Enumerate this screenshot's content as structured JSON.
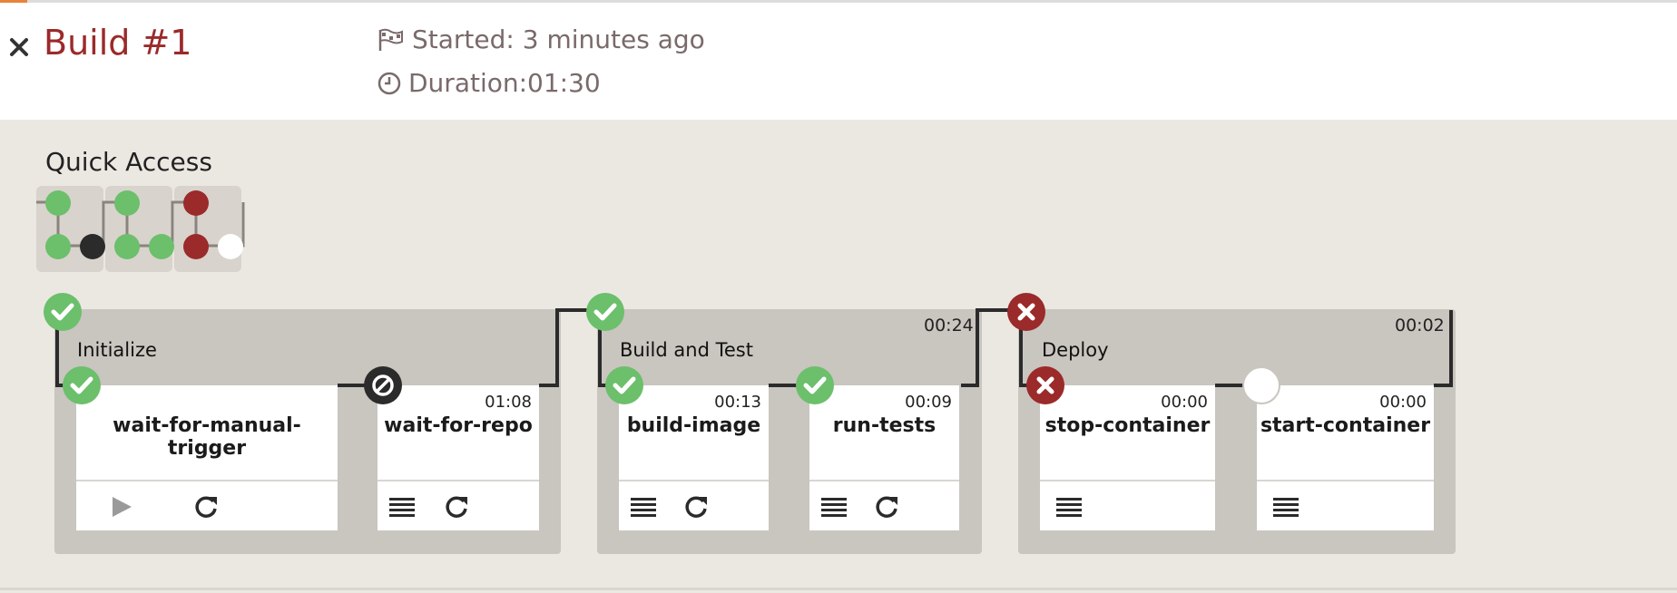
{
  "header": {
    "close_icon": "close-x-icon",
    "title": "Build #1",
    "started": "Started: 3 minutes ago",
    "duration": "Duration:01:30",
    "started_icon": "flag-icon",
    "duration_icon": "clock-icon"
  },
  "colors": {
    "title": "#9b2a2a",
    "success": "#6cbf6b",
    "failure": "#9b2a2a",
    "blocked": "#2b2b2b",
    "pending": "#ffffff",
    "stage_bg": "#c9c5bf",
    "page_bg": "#ebe8e2"
  },
  "quick_access": {
    "title": "Quick Access",
    "tiles": [
      {
        "stage": "Initialize",
        "status": "success",
        "jobs": [
          "success",
          "blocked"
        ]
      },
      {
        "stage": "Build and Test",
        "status": "success",
        "jobs": [
          "success",
          "success"
        ]
      },
      {
        "stage": "Deploy",
        "status": "failure",
        "jobs": [
          "failure",
          "pending"
        ]
      }
    ]
  },
  "stages": [
    {
      "name": "Initialize",
      "status": "success",
      "time": "",
      "jobs": [
        {
          "name": "wait-for-manual-trigger",
          "status": "success",
          "time": "",
          "actions": [
            "play-icon",
            "rerun-icon"
          ]
        },
        {
          "name": "wait-for-repo",
          "status": "blocked",
          "time": "01:08",
          "actions": [
            "log-icon",
            "rerun-icon"
          ]
        }
      ]
    },
    {
      "name": "Build and Test",
      "status": "success",
      "time": "00:24",
      "jobs": [
        {
          "name": "build-image",
          "status": "success",
          "time": "00:13",
          "actions": [
            "log-icon",
            "rerun-icon"
          ]
        },
        {
          "name": "run-tests",
          "status": "success",
          "time": "00:09",
          "actions": [
            "log-icon",
            "rerun-icon"
          ]
        }
      ]
    },
    {
      "name": "Deploy",
      "status": "failure",
      "time": "00:02",
      "jobs": [
        {
          "name": "stop-container",
          "status": "failure",
          "time": "00:00",
          "actions": [
            "log-icon"
          ]
        },
        {
          "name": "start-container",
          "status": "pending",
          "time": "00:00",
          "actions": [
            "log-icon"
          ]
        }
      ]
    }
  ]
}
